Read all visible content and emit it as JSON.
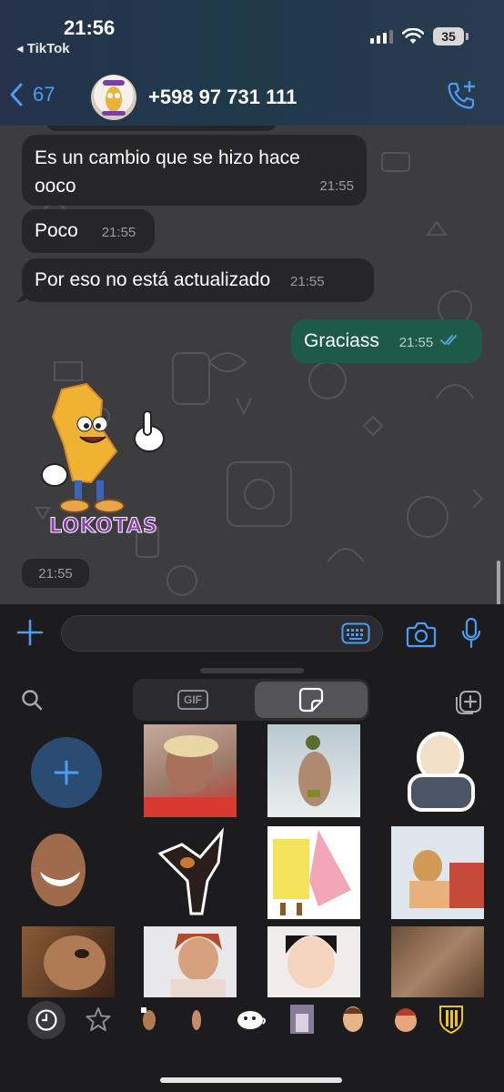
{
  "status_bar": {
    "time": "21:56",
    "back_app": "◂ TikTok",
    "battery": "35"
  },
  "header": {
    "back_count": "67",
    "contact_title": "+598 97 731 111"
  },
  "messages": [
    {
      "line1": "Es un cambio que se hizo hace",
      "line2": "ooco",
      "time": "21:55",
      "direction": "in"
    },
    {
      "text": "Poco",
      "time": "21:55",
      "direction": "in"
    },
    {
      "text": "Por eso no está actualizado",
      "time": "21:55",
      "direction": "in"
    },
    {
      "text": "Graciass",
      "time": "21:55",
      "direction": "out",
      "status": "read"
    }
  ],
  "sticker_message": {
    "brand_text": "LOKOTAS",
    "time": "21:55"
  },
  "sticker_panel": {
    "gif_tab_label": "GIF",
    "selected_tab": "stickers"
  },
  "colors": {
    "accent": "#4c9cf3",
    "chat_bg": "#3d3d3f",
    "bubble_in": "#262628",
    "bubble_out": "#1e5a48",
    "read_ticks": "#5aa8f2"
  }
}
